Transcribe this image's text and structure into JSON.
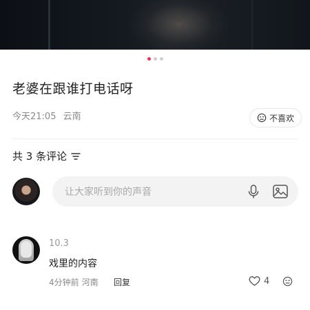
{
  "post": {
    "title": "老婆在跟谁打电话呀",
    "time": "今天21:05",
    "location": "云南",
    "dislike_label": "不喜欢"
  },
  "carousel": {
    "count": 3,
    "active_index": 0
  },
  "comments_header": {
    "label": "共 3 条评论"
  },
  "comment_input": {
    "placeholder": "让大家听到你的声音"
  },
  "comments": [
    {
      "username": "10.3",
      "text": "戏里的内容",
      "time": "4分钟前",
      "location": "河南",
      "reply_label": "回复",
      "likes": "4"
    }
  ],
  "colors": {
    "accent": "#ff2b55",
    "muted_text": "#8a8a8a",
    "input_bg": "#f3f3f3"
  },
  "icons": [
    "sort-icon",
    "microphone-icon",
    "image-icon",
    "heart-icon",
    "dislike-face-icon"
  ]
}
